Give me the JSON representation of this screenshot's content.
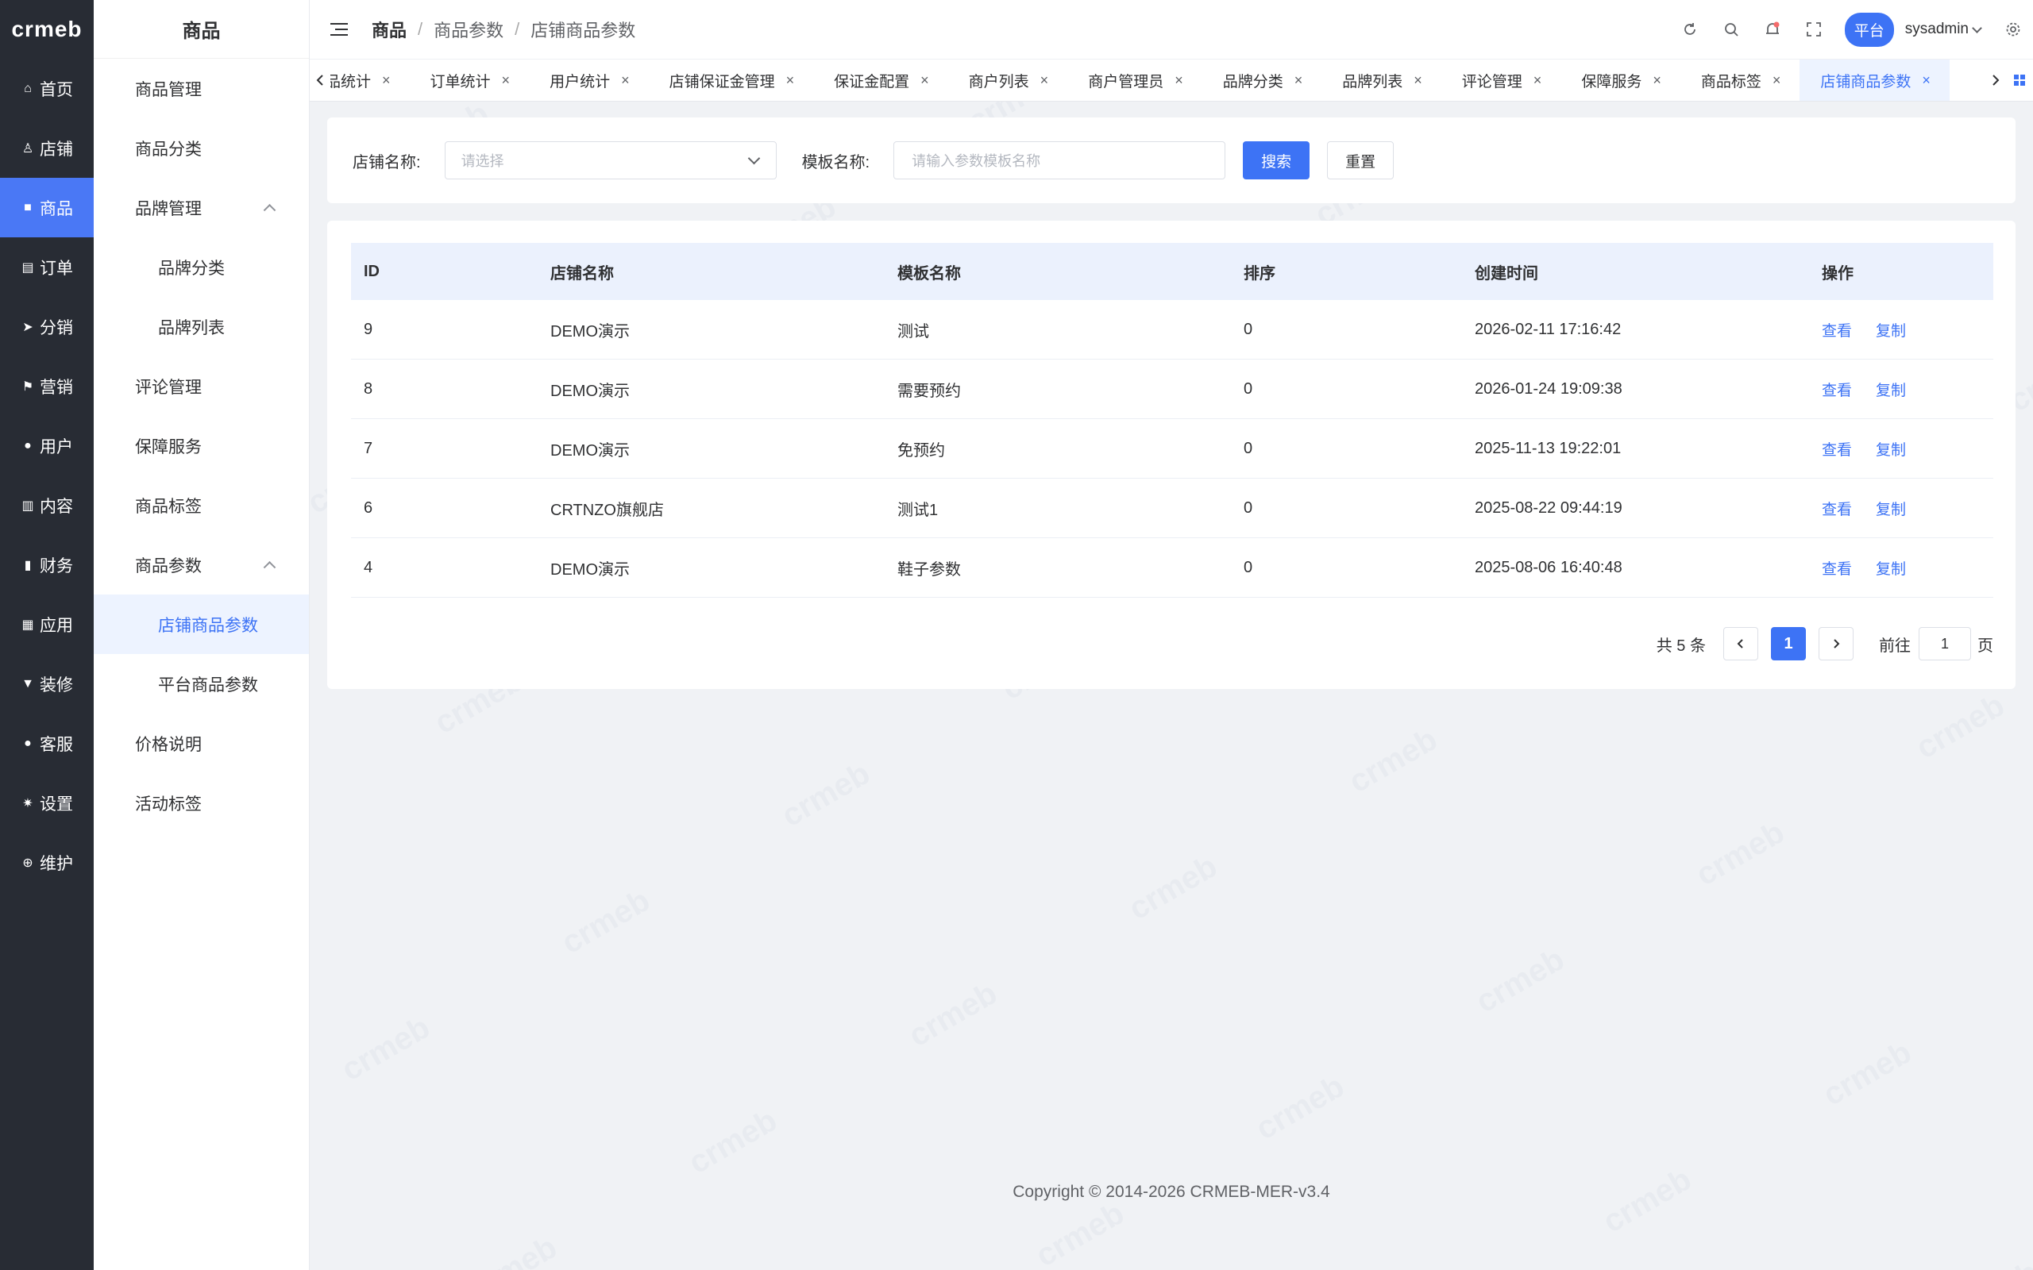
{
  "logo": "crmeb",
  "rail": {
    "items": [
      {
        "label": "首页",
        "icon": "home-icon",
        "glyph": "⌂"
      },
      {
        "label": "店铺",
        "icon": "store-icon",
        "glyph": "♙"
      },
      {
        "label": "商品",
        "icon": "bag-icon",
        "glyph": "■"
      },
      {
        "label": "订单",
        "icon": "order-icon",
        "glyph": "▤"
      },
      {
        "label": "分销",
        "icon": "send-icon",
        "glyph": "➤"
      },
      {
        "label": "营销",
        "icon": "flag-icon",
        "glyph": "⚑"
      },
      {
        "label": "用户",
        "icon": "user-icon",
        "glyph": "●"
      },
      {
        "label": "内容",
        "icon": "content-icon",
        "glyph": "▥"
      },
      {
        "label": "财务",
        "icon": "finance-icon",
        "glyph": "▮"
      },
      {
        "label": "应用",
        "icon": "apps-icon",
        "glyph": "▦"
      },
      {
        "label": "装修",
        "icon": "brush-icon",
        "glyph": "▼"
      },
      {
        "label": "客服",
        "icon": "service-icon",
        "glyph": "●"
      },
      {
        "label": "设置",
        "icon": "gear-icon",
        "glyph": "✷"
      },
      {
        "label": "维护",
        "icon": "maintain-icon",
        "glyph": "⊕"
      }
    ],
    "active_index": 2
  },
  "submenu": {
    "title": "商品",
    "items": [
      {
        "label": "商品管理",
        "level": 1
      },
      {
        "label": "商品分类",
        "level": 1
      },
      {
        "label": "品牌管理",
        "level": 1,
        "expanded": true
      },
      {
        "label": "品牌分类",
        "level": 2
      },
      {
        "label": "品牌列表",
        "level": 2
      },
      {
        "label": "评论管理",
        "level": 1
      },
      {
        "label": "保障服务",
        "level": 1
      },
      {
        "label": "商品标签",
        "level": 1
      },
      {
        "label": "商品参数",
        "level": 1,
        "expanded": true
      },
      {
        "label": "店铺商品参数",
        "level": 2,
        "active": true
      },
      {
        "label": "平台商品参数",
        "level": 2
      },
      {
        "label": "价格说明",
        "level": 1
      },
      {
        "label": "活动标签",
        "level": 1
      }
    ]
  },
  "header": {
    "breadcrumb": [
      "商品",
      "商品参数",
      "店铺商品参数"
    ],
    "platform_badge": "平台",
    "username": "sysadmin"
  },
  "tabs": [
    {
      "label": "品统计"
    },
    {
      "label": "订单统计"
    },
    {
      "label": "用户统计"
    },
    {
      "label": "店铺保证金管理"
    },
    {
      "label": "保证金配置"
    },
    {
      "label": "商户列表"
    },
    {
      "label": "商户管理员"
    },
    {
      "label": "品牌分类"
    },
    {
      "label": "品牌列表"
    },
    {
      "label": "评论管理"
    },
    {
      "label": "保障服务"
    },
    {
      "label": "商品标签"
    },
    {
      "label": "店铺商品参数",
      "active": true
    }
  ],
  "filters": {
    "store_label": "店铺名称:",
    "store_placeholder": "请选择",
    "template_label": "模板名称:",
    "template_placeholder": "请输入参数模板名称",
    "search_button": "搜索",
    "reset_button": "重置"
  },
  "table": {
    "columns": [
      "ID",
      "店铺名称",
      "模板名称",
      "排序",
      "创建时间",
      "操作"
    ],
    "rows": [
      {
        "id": "9",
        "store": "DEMO演示",
        "template": "测试",
        "sort": "0",
        "created": "2026-02-11 17:16:42"
      },
      {
        "id": "8",
        "store": "DEMO演示",
        "template": "需要预约",
        "sort": "0",
        "created": "2026-01-24 19:09:38"
      },
      {
        "id": "7",
        "store": "DEMO演示",
        "template": "免预约",
        "sort": "0",
        "created": "2025-11-13 19:22:01"
      },
      {
        "id": "6",
        "store": "CRTNZO旗舰店",
        "template": "测试1",
        "sort": "0",
        "created": "2025-08-22 09:44:19"
      },
      {
        "id": "4",
        "store": "DEMO演示",
        "template": "鞋子参数",
        "sort": "0",
        "created": "2025-08-06 16:40:48"
      }
    ],
    "actions": {
      "view": "查看",
      "copy": "复制"
    }
  },
  "pagination": {
    "total": "共 5 条",
    "current_page": "1",
    "goto_label": "前往",
    "goto_value": "1",
    "page_suffix": "页"
  },
  "footer": "Copyright © 2014-2026 CRMEB-MER-v3.4",
  "colors": {
    "accent": "#3d73f5",
    "rail_bg": "#282c34",
    "header_row": "#ebf1fd"
  }
}
